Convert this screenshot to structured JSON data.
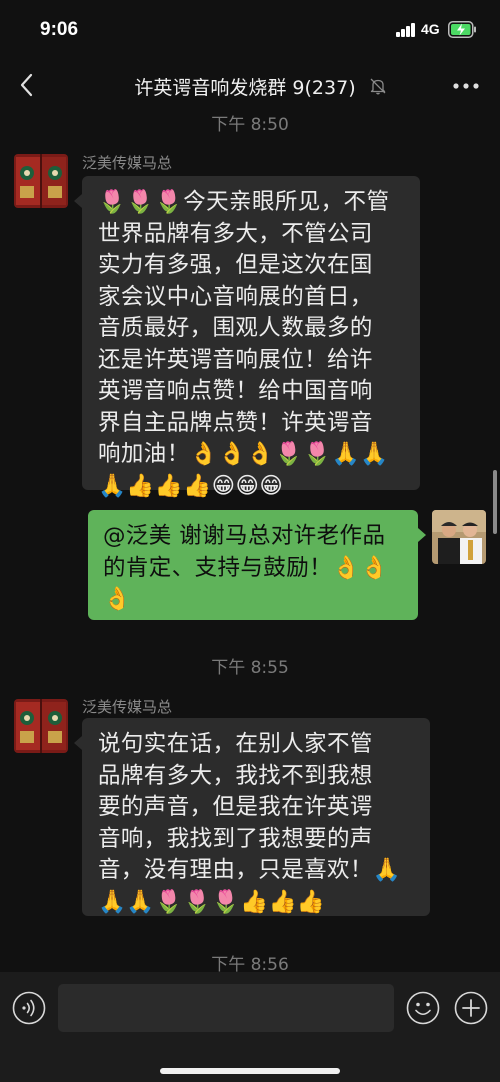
{
  "status_bar": {
    "time": "9:06",
    "network": "4G"
  },
  "nav": {
    "title": "许英谔音响发烧群 9(237)"
  },
  "messages": {
    "ts1": "下午 8:50",
    "sender1": "泛美传媒马总",
    "msg1_lines": [
      "🌷🌷🌷今天亲眼所见，不管",
      "世界品牌有多大，不管公司",
      "实力有多强，但是这次在国",
      "家会议中心音响展的首日，",
      "音质最好，围观人数最多的",
      "还是许英谔音响展位！给许",
      "英谔音响点赞！给中国音响",
      "界自主品牌点赞！许英谔音",
      "响加油！👌👌👌🌷🌷🙏🙏",
      "🙏👍👍👍😁😁😁"
    ],
    "msg2_lines": [
      "@泛美 谢谢马总对许老作品",
      "的肯定、支持与鼓励！👌👌",
      "👌"
    ],
    "ts2": "下午 8:55",
    "sender2": "泛美传媒马总",
    "msg3_lines": [
      "说句实在话，在别人家不管",
      "品牌有多大，我找不到我想",
      "要的声音，但是我在许英谔",
      "音响，我找到了我想要的声",
      "音，没有理由，只是喜欢！🙏",
      "🙏🙏🌷🌷🌷👍👍👍"
    ],
    "ts3": "下午 8:56"
  },
  "colors": {
    "bubble_in": "#2c2c2c",
    "bubble_out": "#5fb35a",
    "background": "#111111"
  },
  "icons": [
    "back-icon",
    "mute-icon",
    "more-icon",
    "voice-icon",
    "emoji-icon",
    "plus-icon"
  ]
}
